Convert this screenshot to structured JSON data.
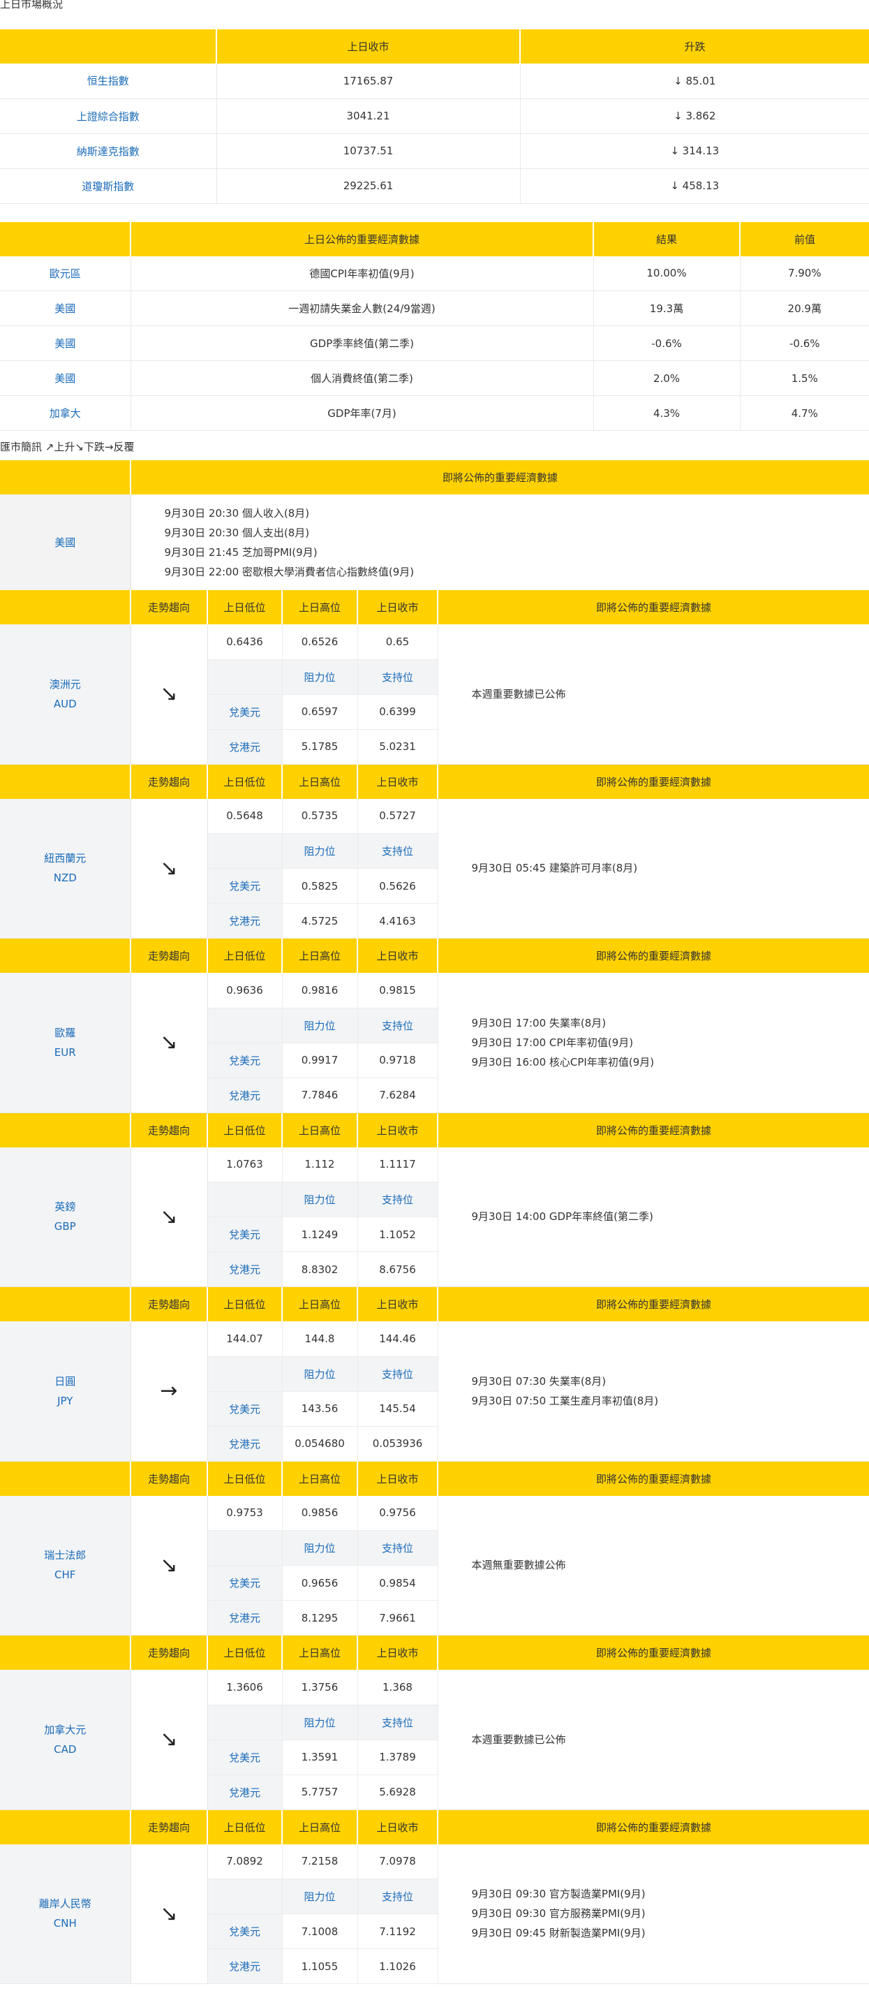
{
  "market": {
    "title": "上日市場概況",
    "headers": [
      "",
      "上日收市",
      "升跌"
    ],
    "rows": [
      {
        "name": "恒生指數",
        "close": "17165.87",
        "change": "↓ 85.01"
      },
      {
        "name": "上證綜合指數",
        "close": "3041.21",
        "change": "↓ 3.862"
      },
      {
        "name": "納斯達克指數",
        "close": "10737.51",
        "change": "↓ 314.13"
      },
      {
        "name": "道瓊斯指數",
        "close": "29225.61",
        "change": "↓ 458.13"
      }
    ]
  },
  "econ": {
    "headers": [
      "",
      "上日公佈的重要經濟數據",
      "結果",
      "前值"
    ],
    "rows": [
      {
        "region": "歐元區",
        "item": "德國CPI年率初值(9月)",
        "result": "10.00%",
        "prev": "7.90%"
      },
      {
        "region": "美國",
        "item": "一週初請失業金人數(24/9當週)",
        "result": "19.3萬",
        "prev": "20.9萬"
      },
      {
        "region": "美國",
        "item": "GDP季率終值(第二季)",
        "result": "-0.6%",
        "prev": "-0.6%"
      },
      {
        "region": "美國",
        "item": "個人消費終值(第二季)",
        "result": "2.0%",
        "prev": "1.5%"
      },
      {
        "region": "加拿大",
        "item": "GDP年率(7月)",
        "result": "4.3%",
        "prev": "4.7%"
      }
    ]
  },
  "fx": {
    "title": "匯市簡訊 ↗上升↘下跌→反覆",
    "upcoming_header": "即將公佈的重要經濟數據",
    "us": {
      "name": "美國",
      "events": [
        "9月30日 20:30 個人收入(8月)",
        "9月30日 20:30 個人支出(8月)",
        "9月30日 21:45 芝加哥PMI(9月)",
        "9月30日 22:00 密歇根大學消費者信心指數終值(9月)"
      ]
    },
    "col_headers": {
      "trend": "走勢趨向",
      "low": "上日低位",
      "high": "上日高位",
      "close": "上日收市",
      "upcoming": "即將公佈的重要經濟數據",
      "resistance": "阻力位",
      "support": "支持位",
      "vs_usd": "兌美元",
      "vs_hkd": "兌港元"
    },
    "currencies": [
      {
        "name": "澳洲元",
        "code": "AUD",
        "trend": "↘",
        "low": "0.6436",
        "high": "0.6526",
        "close": "0.65",
        "usd_res": "0.6597",
        "usd_sup": "0.6399",
        "hkd_res": "5.1785",
        "hkd_sup": "5.0231",
        "events": [
          "本週重要數據已公佈"
        ]
      },
      {
        "name": "紐西蘭元",
        "code": "NZD",
        "trend": "↘",
        "low": "0.5648",
        "high": "0.5735",
        "close": "0.5727",
        "usd_res": "0.5825",
        "usd_sup": "0.5626",
        "hkd_res": "4.5725",
        "hkd_sup": "4.4163",
        "events": [
          "9月30日 05:45 建築許可月率(8月)"
        ]
      },
      {
        "name": "歐羅",
        "code": "EUR",
        "trend": "↘",
        "low": "0.9636",
        "high": "0.9816",
        "close": "0.9815",
        "usd_res": "0.9917",
        "usd_sup": "0.9718",
        "hkd_res": "7.7846",
        "hkd_sup": "7.6284",
        "events": [
          "9月30日 17:00 失業率(8月)",
          "9月30日 17:00 CPI年率初值(9月)",
          "9月30日 16:00 核心CPI年率初值(9月)"
        ]
      },
      {
        "name": "英鎊",
        "code": "GBP",
        "trend": "↘",
        "low": "1.0763",
        "high": "1.112",
        "close": "1.1117",
        "usd_res": "1.1249",
        "usd_sup": "1.1052",
        "hkd_res": "8.8302",
        "hkd_sup": "8.6756",
        "events": [
          "9月30日 14:00 GDP年率終值(第二季)"
        ]
      },
      {
        "name": "日圓",
        "code": "JPY",
        "trend": "→",
        "low": "144.07",
        "high": "144.8",
        "close": "144.46",
        "usd_res": "143.56",
        "usd_sup": "145.54",
        "hkd_res": "0.054680",
        "hkd_sup": "0.053936",
        "events": [
          "9月30日 07:30 失業率(8月)",
          "9月30日 07:50 工業生產月率初值(8月)"
        ]
      },
      {
        "name": "瑞士法郎",
        "code": "CHF",
        "trend": "↘",
        "low": "0.9753",
        "high": "0.9856",
        "close": "0.9756",
        "usd_res": "0.9656",
        "usd_sup": "0.9854",
        "hkd_res": "8.1295",
        "hkd_sup": "7.9661",
        "events": [
          "本週無重要數據公佈"
        ]
      },
      {
        "name": "加拿大元",
        "code": "CAD",
        "trend": "↘",
        "low": "1.3606",
        "high": "1.3756",
        "close": "1.368",
        "usd_res": "1.3591",
        "usd_sup": "1.3789",
        "hkd_res": "5.7757",
        "hkd_sup": "5.6928",
        "events": [
          "本週重要數據已公佈"
        ]
      },
      {
        "name": "離岸人民幣",
        "code": "CNH",
        "trend": "↘",
        "low": "7.0892",
        "high": "7.2158",
        "close": "7.0978",
        "usd_res": "7.1008",
        "usd_sup": "7.1192",
        "hkd_res": "1.1055",
        "hkd_sup": "1.1026",
        "events": [
          "9月30日 09:30 官方製造業PMI(9月)",
          "9月30日 09:30 官方服務業PMI(9月)",
          "9月30日 09:45 財新製造業PMI(9月)"
        ]
      }
    ]
  }
}
